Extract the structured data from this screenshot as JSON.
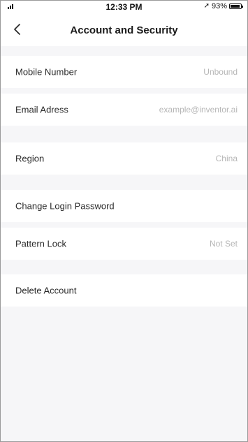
{
  "status_bar": {
    "time": "12:33 PM",
    "battery": "93%",
    "icons": [
      "signal-icon",
      "location-icon",
      "battery-icon"
    ]
  },
  "header": {
    "title": "Account and Security",
    "back_icon": "chevron-left-icon"
  },
  "rows": [
    {
      "label": "Mobile Number",
      "value": "Unbound"
    },
    {
      "label": "Email Adress",
      "value": "example@inventor.ai"
    },
    {
      "label": "Region",
      "value": "China"
    },
    {
      "label": "Change Login Password",
      "value": ""
    },
    {
      "label": "Pattern Lock",
      "value": "Not Set"
    },
    {
      "label": "Delete Account",
      "value": ""
    }
  ],
  "colors": {
    "background": "#f6f6f8",
    "row_background": "#ffffff",
    "label_text": "#2a2a2a",
    "value_text": "#b6b6b6"
  }
}
